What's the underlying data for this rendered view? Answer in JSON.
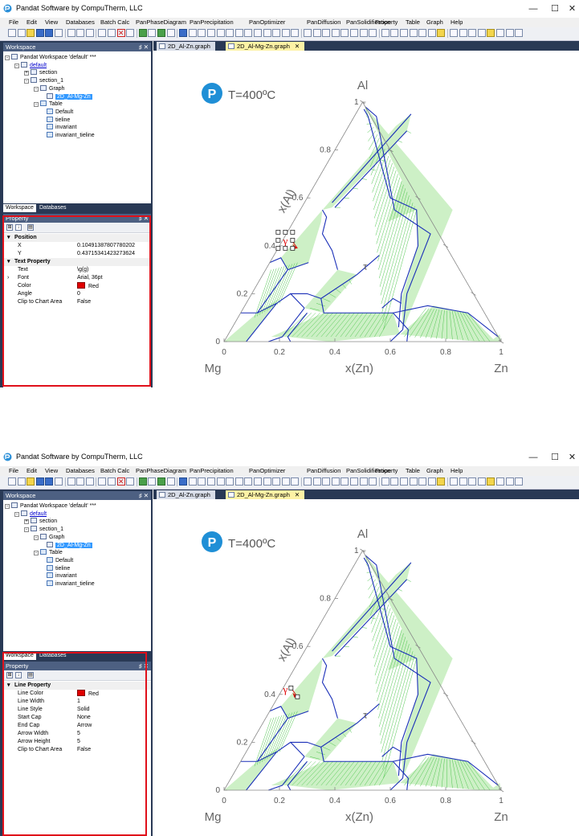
{
  "app": {
    "title": "Pandat Software by CompuTherm, LLC",
    "window_controls": [
      "—",
      "☐",
      "✕"
    ],
    "menu": [
      "File",
      "Edit",
      "View",
      "Databases",
      "Batch Calc",
      "PanPhaseDiagram",
      "PanPrecipitation",
      "PanOptimizer",
      "PanDiffusion",
      "PanSolidification",
      "Property",
      "Table",
      "Graph",
      "Help"
    ]
  },
  "workspace": {
    "panel_title": "Workspace",
    "panel_controls": "♯ ✕",
    "root": "Pandat Workspace 'default' ***",
    "project": "default",
    "items": [
      "section",
      "section_1",
      "Graph",
      "2D_Al-Mg-Zn",
      "Table",
      "Default",
      "tieline",
      "invariant",
      "invariant_tieline"
    ],
    "tabs": [
      "Workspace",
      "Databases"
    ]
  },
  "doc_tabs": [
    {
      "label": "2D_Al-Zn.graph",
      "active": false
    },
    {
      "label": "2D_Al-Mg-Zn.graph",
      "active": true,
      "close": "✕"
    }
  ],
  "property_panel": {
    "title": "Property",
    "controls": "♯ ✕",
    "tool_labels": [
      "⊞",
      "↓",
      "▤"
    ]
  },
  "screens": [
    {
      "properties": [
        {
          "type": "category",
          "label": "Position"
        },
        {
          "type": "row",
          "key": "X",
          "value": "0.10491387807780202"
        },
        {
          "type": "row",
          "key": "Y",
          "value": "0.43715341423273624"
        },
        {
          "type": "category",
          "label": "Text Property"
        },
        {
          "type": "row",
          "key": "Text",
          "value": "\\g(g)"
        },
        {
          "type": "row",
          "key": "Font",
          "value": "Arial, 36pt",
          "expandable": true
        },
        {
          "type": "row",
          "key": "Color",
          "value": "Red",
          "swatch": "#e00000"
        },
        {
          "type": "row",
          "key": "Angle",
          "value": "0"
        },
        {
          "type": "row",
          "key": "Clip to Chart Area",
          "value": "False"
        }
      ]
    },
    {
      "properties": [
        {
          "type": "category",
          "label": "Line Property"
        },
        {
          "type": "row",
          "key": "Line Color",
          "value": "Red",
          "swatch": "#e00000"
        },
        {
          "type": "row",
          "key": "Line Width",
          "value": "1"
        },
        {
          "type": "row",
          "key": "Line Style",
          "value": "Solid"
        },
        {
          "type": "row",
          "key": "Start Cap",
          "value": "None"
        },
        {
          "type": "row",
          "key": "End Cap",
          "value": "Arrow"
        },
        {
          "type": "row",
          "key": "Arrow Width",
          "value": "5"
        },
        {
          "type": "row",
          "key": "Arrow Height",
          "value": "5"
        },
        {
          "type": "row",
          "key": "Clip to Chart Area",
          "value": "False"
        }
      ]
    }
  ],
  "chart_data": {
    "type": "ternary",
    "title": "T=400ºC",
    "logo_letter": "P",
    "corner_labels": {
      "top": "Al",
      "left": "Mg",
      "right": "Zn"
    },
    "xlabel": "x(Zn)",
    "ylabel": "x(Al)",
    "xticks": [
      "0",
      "0.2",
      "0.4",
      "0.6",
      "0.8",
      "1"
    ],
    "yticks": [
      "0",
      "0.2",
      "0.4",
      "0.6",
      "0.8",
      "1"
    ],
    "annotations": [
      "γ",
      "τ"
    ],
    "colors": {
      "boundary": "#1a2fb8",
      "tieline": "#4fc64f",
      "two_phase_fill": "#cdf0c6",
      "axis": "#888888",
      "annotation_red": "#e00000"
    }
  }
}
